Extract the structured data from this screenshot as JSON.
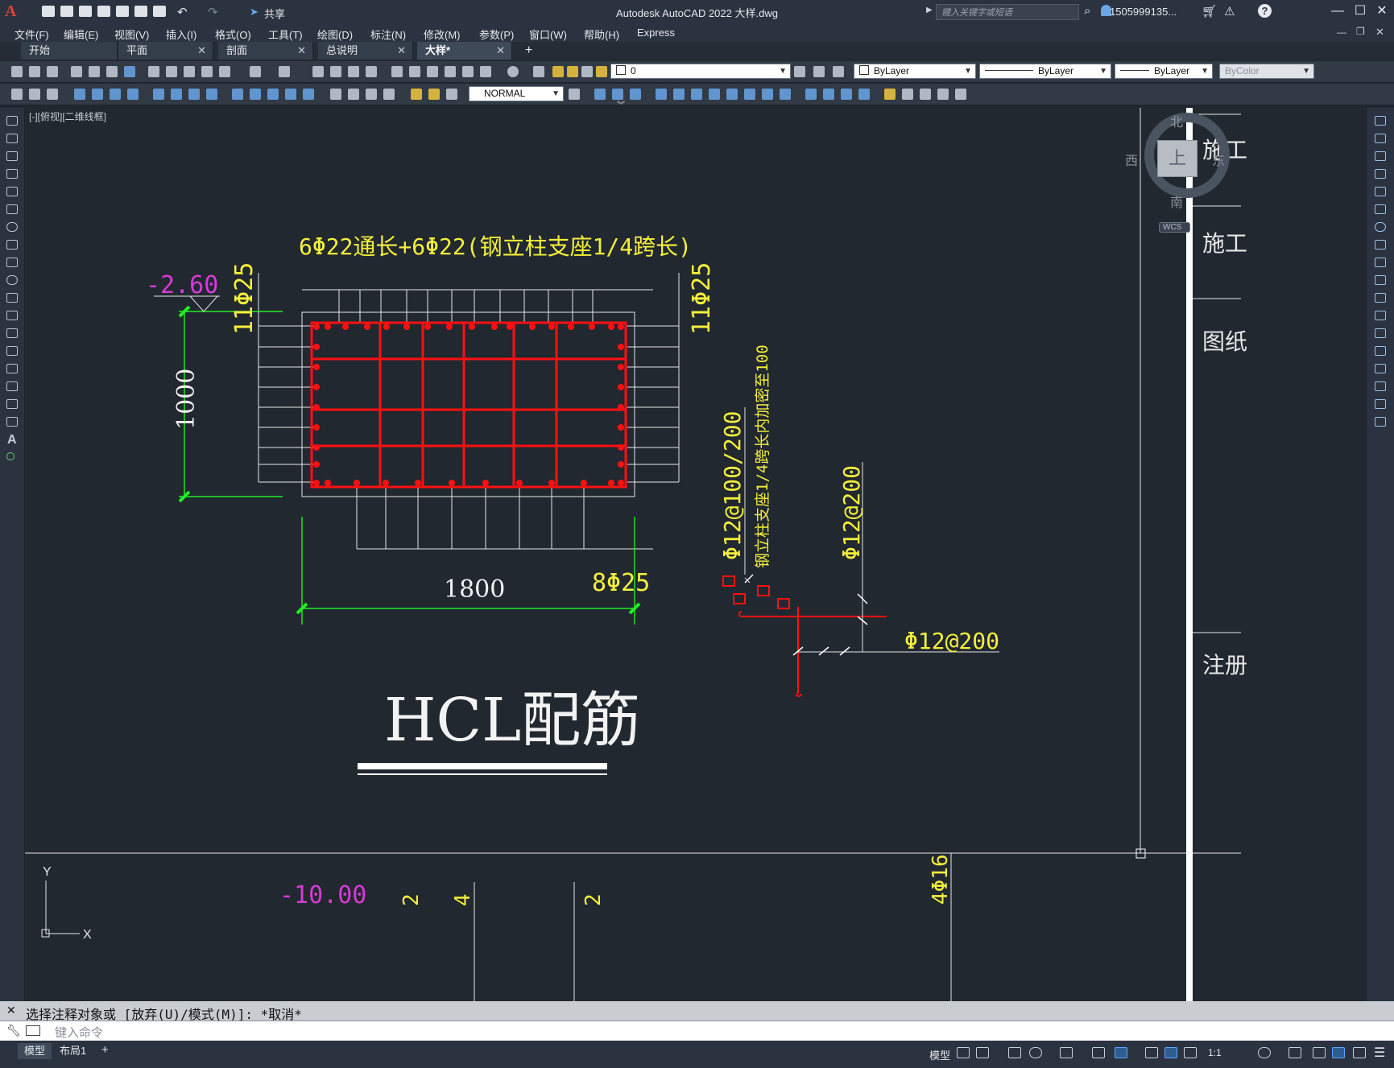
{
  "app": {
    "logo": "A",
    "title": "Autodesk AutoCAD 2022    大样.dwg",
    "share_label": "共享",
    "search_placeholder": "键入关键字或短语",
    "user_name": "1505999135...",
    "window_controls": [
      "—",
      "☐",
      "✕"
    ]
  },
  "menu": {
    "items": [
      "文件(F)",
      "编辑(E)",
      "视图(V)",
      "插入(I)",
      "格式(O)",
      "工具(T)",
      "绘图(D)",
      "标注(N)",
      "修改(M)",
      "参数(P)",
      "窗口(W)",
      "帮助(H)",
      "Express"
    ]
  },
  "tabs": {
    "items": [
      "开始",
      "平面",
      "剖面",
      "总说明",
      "大样*"
    ],
    "active": "大样*",
    "add_label": "+"
  },
  "toolbar": {
    "layer_value": "0",
    "color_value": "ByLayer",
    "linetype_value": "ByLayer",
    "lineweight_value": "ByLayer",
    "plotstyle_value": "ByColor",
    "dimstyle_value": "NORMAL"
  },
  "viewport": {
    "label": "[-][俯视][二维线框]"
  },
  "viewcube": {
    "north": "北",
    "south": "南",
    "east": "东",
    "west": "西",
    "face": "上",
    "wcs": "WCS"
  },
  "drawing": {
    "top_label": "6Φ22通长+6Φ22(钢立柱支座1/4跨长)",
    "elevation_top": "-2.60",
    "left_bars": "11Φ25",
    "right_bars": "11Φ25",
    "height_dim": "1000",
    "bottom_bars": "8Φ25",
    "width_dim": "1800",
    "stirrup_main": "Φ12@100/200",
    "stirrup_note": "钢立柱支座1/4跨长内加密至100",
    "stirrup_inner": "Φ12@200",
    "stirrup_right": "Φ12@200",
    "section_title": "HCL配筋",
    "elevation_bottom": "-10.00",
    "bottom_num1": "2",
    "bottom_num2": "4",
    "bottom_num3": "2",
    "bottom_bars2": "4Φ16",
    "axis_y": "Y",
    "axis_x": "X",
    "title_block": [
      "施工",
      "施工",
      "图纸",
      "注册"
    ]
  },
  "command": {
    "history": "选择注释对象或 [放弃(U)/模式(M)]: *取消*",
    "placeholder": "键入命令"
  },
  "status": {
    "layout_tabs": [
      "模型",
      "布局1"
    ],
    "active_layout": "模型",
    "model_label": "模型",
    "scale": "1:1"
  }
}
